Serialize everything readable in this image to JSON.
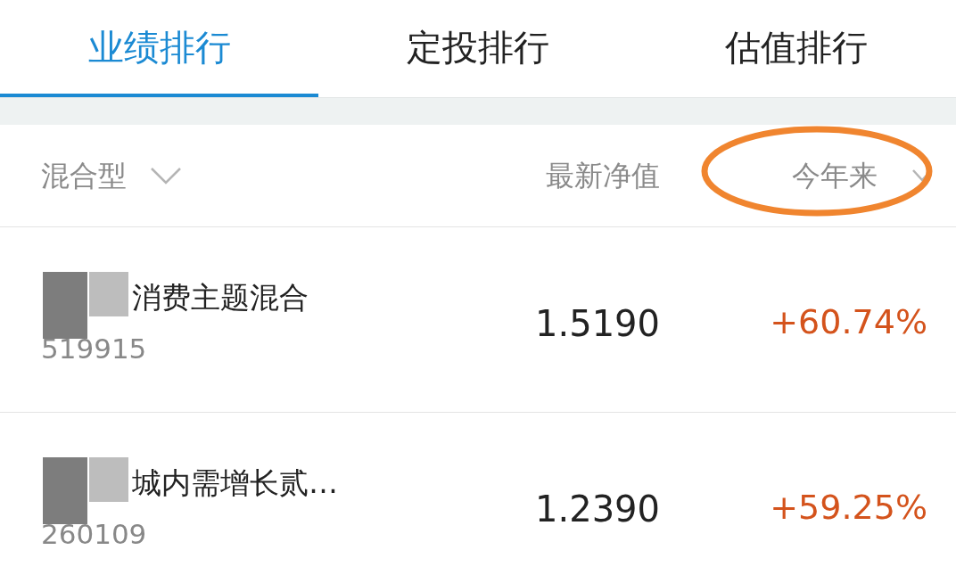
{
  "tabs": [
    {
      "label": "业绩排行",
      "selected": true
    },
    {
      "label": "定投排行",
      "selected": false
    },
    {
      "label": "估值排行",
      "selected": false
    }
  ],
  "filter": {
    "label": "混合型"
  },
  "columns": [
    "最新净值",
    "今年来"
  ],
  "rows": [
    {
      "name": "消费主题混合",
      "code": "519915",
      "nav": "1.5190",
      "change": "+60.74%"
    },
    {
      "name": "城内需增长贰…",
      "code": "260109",
      "nav": "1.2390",
      "change": "+59.25%"
    }
  ]
}
